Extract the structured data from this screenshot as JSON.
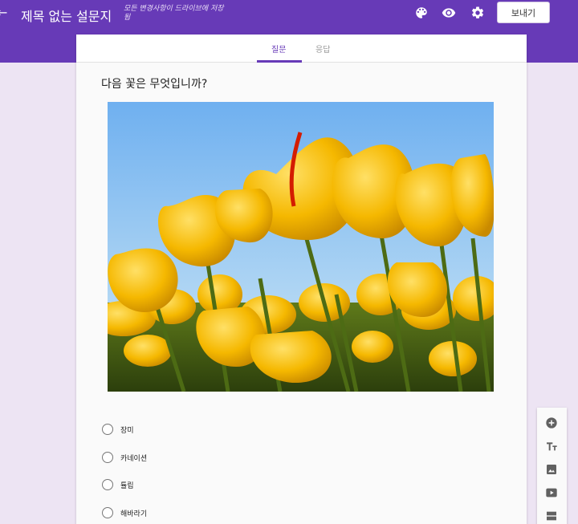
{
  "header": {
    "back_glyph": "←",
    "title": "제목 없는 설문지",
    "save_status": "모든 변경사항이 드라이브에 저장됨",
    "send_label": "보내기",
    "accent_color": "#673ab7"
  },
  "tabs": [
    {
      "label": "질문",
      "active": true
    },
    {
      "label": "응답",
      "active": false
    }
  ],
  "question": {
    "text": "다음 꽃은 무엇입니까?",
    "options": [
      "장미",
      "카네이션",
      "튤립",
      "해바라기"
    ]
  },
  "icons": {
    "top": [
      "palette-icon",
      "eye-icon",
      "gear-icon"
    ],
    "side": [
      "add-question-icon",
      "add-title-icon",
      "add-image-icon",
      "add-video-icon",
      "add-section-icon"
    ]
  }
}
